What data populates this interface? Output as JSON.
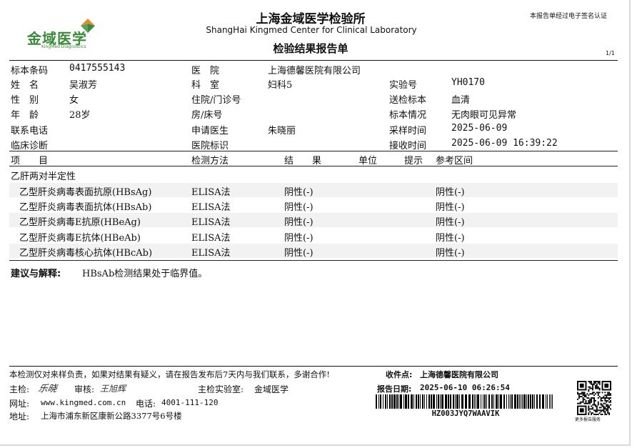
{
  "header": {
    "logo_text": "金域医学",
    "logo_sub": "KingMed Diagnostics",
    "title_cn": "上海金域医学检验所",
    "title_en": "ShangHai Kingmed Center for Clinical Laboratory",
    "report_title": "检验结果报告单",
    "esign_note": "本报告单经过电子签名认证",
    "page_no": "1/1"
  },
  "patient": {
    "barcode_label": "标本条码",
    "barcode_value": "0417555143",
    "name_label": "姓　名",
    "name_value": "吴淑芳",
    "sex_label": "性　别",
    "sex_value": "女",
    "age_label": "年　龄",
    "age_value": "28岁",
    "phone_label": "联系电话",
    "phone_value": "",
    "diagnosis_label": "临床诊断",
    "diagnosis_value": "",
    "hospital_label": "医　院",
    "hospital_value": "上海德馨医院有限公司",
    "dept_label": "科　室",
    "dept_value": "妇科5",
    "inpatient_label": "住院/门诊号",
    "inpatient_value": "",
    "bed_label": "房/床号",
    "bed_value": "",
    "doctor_label": "申请医生",
    "doctor_value": "朱晓丽",
    "hospid_label": "医院标识",
    "hospid_value": "",
    "labno_label": "实验号",
    "labno_value": "YH0170",
    "specimen_label": "送检标本",
    "specimen_value": "血清",
    "condition_label": "标本情况",
    "condition_value": "无肉眼可见异常",
    "collect_label": "采样时间",
    "collect_value": "2025-06-09",
    "receive_label": "接收时间",
    "receive_value": "2025-06-09 16:39:22"
  },
  "table": {
    "headers": {
      "item": "项　　目",
      "method": "检测方法",
      "result": "结　　果",
      "unit": "单位",
      "hint": "提示",
      "range": "参考区间"
    },
    "group": "乙肝两对半定性",
    "rows": [
      {
        "item": "乙型肝炎病毒表面抗原(HBsAg)",
        "method": "ELISA法",
        "result": "阴性(-)",
        "unit": "",
        "hint": "",
        "range": "阴性(-)"
      },
      {
        "item": "乙型肝炎病毒表面抗体(HBsAb)",
        "method": "ELISA法",
        "result": "阴性(-)",
        "unit": "",
        "hint": "",
        "range": "阴性(-)"
      },
      {
        "item": "乙型肝炎病毒E抗原(HBeAg)",
        "method": "ELISA法",
        "result": "阴性(-)",
        "unit": "",
        "hint": "",
        "range": "阴性(-)"
      },
      {
        "item": "乙型肝炎病毒E抗体(HBeAb)",
        "method": "ELISA法",
        "result": "阴性(-)",
        "unit": "",
        "hint": "",
        "range": "阴性(-)"
      },
      {
        "item": "乙型肝炎病毒核心抗体(HBcAb)",
        "method": "ELISA法",
        "result": "阴性(-)",
        "unit": "",
        "hint": "",
        "range": "阴性(-)"
      }
    ]
  },
  "advice": {
    "label": "建议与解释:",
    "text": "HBsAb检测结果处于临界值。"
  },
  "footer": {
    "disclaimer": "本检测仅对来样负责，如果对结果有疑义，请在报告发布后7天内与我们联系，多谢合作!",
    "receiver_label": "收件点:",
    "receiver_value": "上海德馨医院有限公司",
    "inspector_label": "主检:",
    "inspector_sign": "乐晓",
    "reviewer_label": "审核:",
    "reviewer_value": "王旭辉",
    "lab_label": "主检实验室:",
    "lab_value": "金域医学",
    "report_date_label": "报告日期:",
    "report_date_value": "2025-06-10 06:26:54",
    "website_label": "网址:",
    "website_value": "www.kingmed.com.cn",
    "tel_label": "电话:",
    "tel_value": "4001-111-120",
    "address_label": "地址:",
    "address_value": "上海市浦东新区康新公路3377号6号楼",
    "barcode_text": "HZ003JYQ7WAAVIK",
    "qr_caption": "更多报告服务"
  },
  "colors": {
    "logo_green": "#3a8a3a",
    "logo_orange": "#e8892b",
    "row_shade": "#f2f2f2"
  }
}
